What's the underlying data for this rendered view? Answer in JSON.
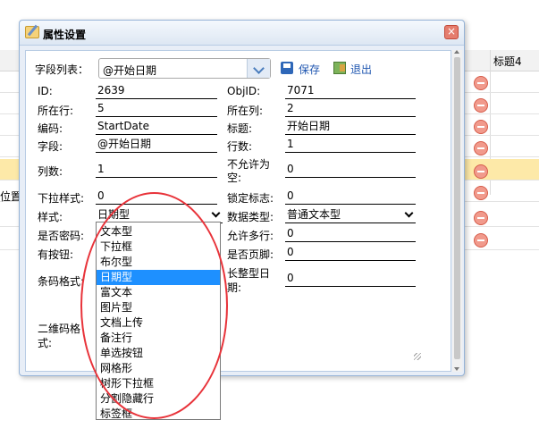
{
  "background": {
    "column_header": "标题4",
    "side_text": "位置"
  },
  "dialog": {
    "title": "属性设置",
    "close": "×",
    "field_list_label": "字段列表：",
    "field_list_value": "@开始日期",
    "save_label": "保存",
    "exit_label": "退出",
    "rows": [
      {
        "l1": "ID:",
        "v1": "2639",
        "l2": "ObjID:",
        "v2": "7071"
      },
      {
        "l1": "所在行:",
        "v1": "5",
        "l2": "所在列:",
        "v2": "2"
      },
      {
        "l1": "编码:",
        "v1": "StartDate",
        "l2": "标题:",
        "v2": "开始日期"
      },
      {
        "l1": "字段:",
        "v1": "@开始日期",
        "l2": "行数:",
        "v2": "1"
      },
      {
        "l1": "列数:",
        "v1": "1",
        "l2a": "不允许为",
        "l2b": "空:",
        "v2": "0"
      },
      {
        "l1": "下拉样式:",
        "v1": "0",
        "l2": "锁定标志:",
        "v2": "0"
      }
    ],
    "style_label": "样式:",
    "style_value": "日期型",
    "datatype_label": "数据类型:",
    "datatype_value": "普通文本型",
    "password_label": "是否密码:",
    "multiline_label": "允许多行:",
    "multiline_value": "0",
    "hasbutton_label": "有按钮:",
    "footer_label": "是否页脚:",
    "footer_value": "0",
    "barcode_label": "条码格式:",
    "longdate_label_a": "长整型日",
    "longdate_label_b": "期:",
    "longdate_value": "0",
    "qrcode_label_a": "二维码格",
    "qrcode_label_b": "式:"
  },
  "style_options": [
    "文本型",
    "下拉框",
    "布尔型",
    "日期型",
    "富文本",
    "图片型",
    "文档上传",
    "备注行",
    "单选按钮",
    "网格形",
    "树形下拉框",
    "分割隐藏行",
    "标签框"
  ],
  "style_selected_index": 3,
  "colors": {
    "accent": "#1e90ff",
    "annotation": "#e8333a"
  }
}
